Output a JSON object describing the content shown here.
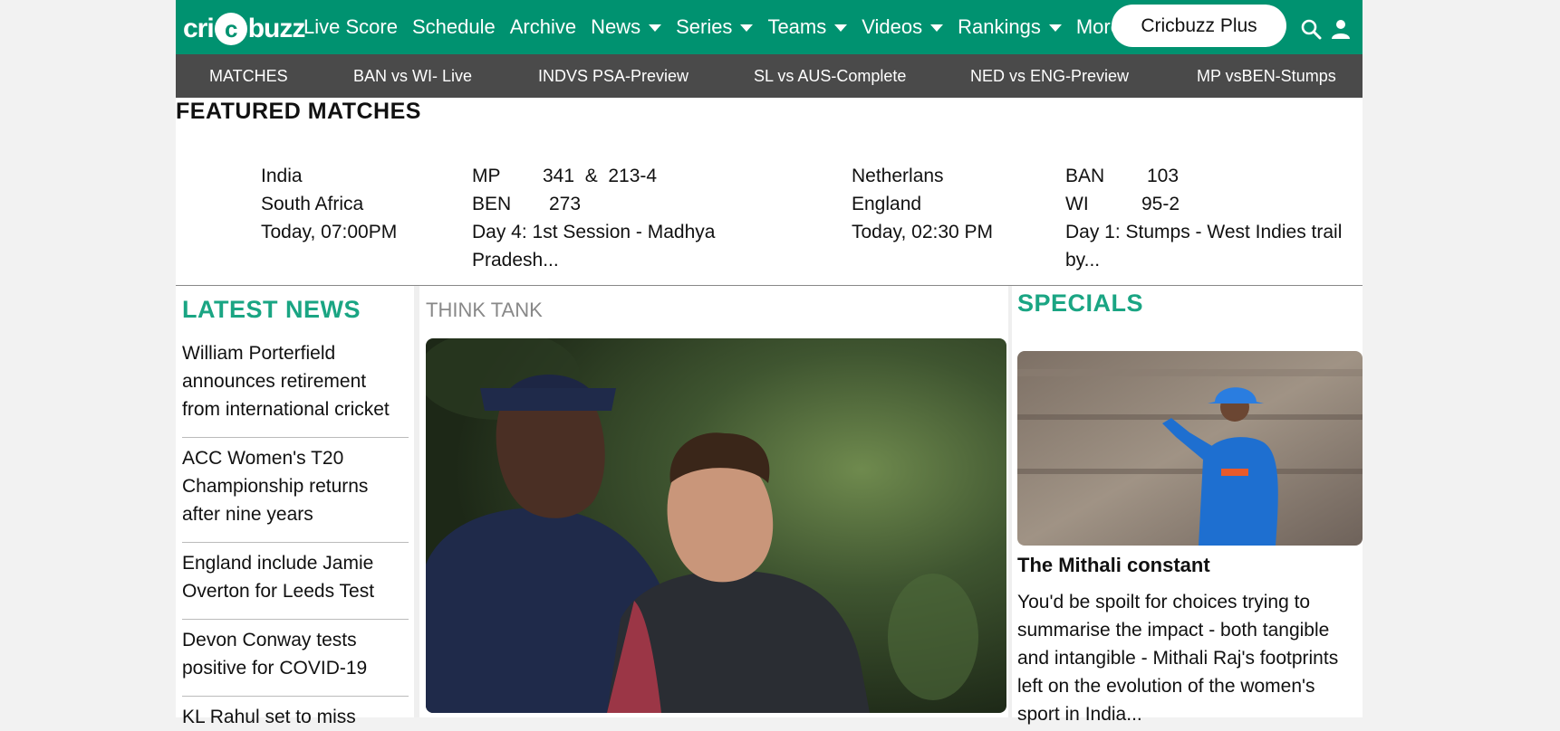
{
  "brand": {
    "logo_pre": "cri",
    "logo_ball": "c",
    "logo_post": "buzz",
    "color": "#009270"
  },
  "nav": {
    "items": [
      {
        "label": "Live Score",
        "dropdown": false
      },
      {
        "label": "Schedule",
        "dropdown": false
      },
      {
        "label": "Archive",
        "dropdown": false
      },
      {
        "label": "News",
        "dropdown": true
      },
      {
        "label": "Series",
        "dropdown": true
      },
      {
        "label": "Teams",
        "dropdown": true
      },
      {
        "label": "Videos",
        "dropdown": true
      },
      {
        "label": "Rankings",
        "dropdown": true
      },
      {
        "label": "More",
        "dropdown": true
      }
    ],
    "plus_label": "Cricbuzz Plus",
    "icons": [
      "search-icon",
      "user-icon"
    ]
  },
  "matchstrip": {
    "items": [
      "MATCHES",
      "BAN vs WI- Live",
      "INDVS PSA-Preview",
      "SL vs AUS-Complete",
      "NED vs ENG-Preview",
      "MP vsBEN-Stumps"
    ]
  },
  "featured": {
    "title": "FEATURED MATCHES",
    "matches": [
      {
        "team1": "India",
        "team2": "South Africa",
        "status": "Today, 07:00PM"
      },
      {
        "team1": "MP",
        "score1": "341  &  213-4",
        "team2": "BEN",
        "score2": "273",
        "status1": "Day 4: 1st Session - Madhya",
        "status2": "Pradesh..."
      },
      {
        "team1": "Netherlans",
        "team2": "England",
        "status": "Today, 02:30 PM"
      },
      {
        "team1": "BAN",
        "score1": "103",
        "team2": "WI",
        "score2": "95-2",
        "status1": "Day 1: Stumps - West Indies trail",
        "status2": "by..."
      }
    ]
  },
  "latest_news": {
    "title": "LATEST NEWS",
    "items": [
      "William Porterfield announces retirement from international cricket",
      "ACC Women's T20 Championship returns after nine years",
      "England include Jamie Overton for Leeds Test",
      "Devon Conway tests positive for COVID-19",
      "KL Rahul set to miss"
    ]
  },
  "think_tank": {
    "label": "THINK TANK"
  },
  "specials": {
    "title": "SPECIALS",
    "headline": "The Mithali constant",
    "text": "You'd be spoilt for choices trying to summarise the impact - both tangible and intangible - Mithali Raj's footprints left on the evolution of the women's sport in India..."
  }
}
